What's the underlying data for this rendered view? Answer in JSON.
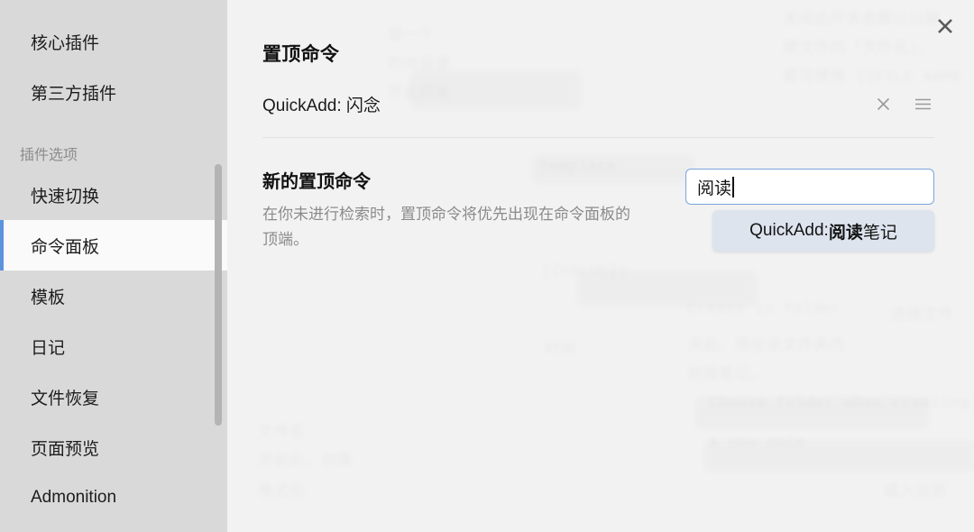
{
  "window": {
    "close_label": "关闭",
    "close_icon": "close-icon"
  },
  "sidebar": {
    "top_items": [
      {
        "label": "核心插件"
      },
      {
        "label": "第三方插件"
      }
    ],
    "section_label": "插件选项",
    "plugin_items": [
      {
        "label": "快速切换",
        "active": false
      },
      {
        "label": "命令面板",
        "active": true
      },
      {
        "label": "模板",
        "active": false
      },
      {
        "label": "日记",
        "active": false
      },
      {
        "label": "文件恢复",
        "active": false
      },
      {
        "label": "页面预览",
        "active": false
      },
      {
        "label": "Admonition",
        "active": false
      }
    ],
    "scrollbar": "vertical-scrollbar",
    "accent_color": "#5c93dd",
    "background_color": "#d9d9d9",
    "active_background_color": "#fafafa"
  },
  "main": {
    "section_title": "置顶命令",
    "pinned_commands": [
      {
        "name": "QuickAdd: 闪念",
        "remove_icon": "close-icon",
        "drag_icon": "hamburger-drag-handle-icon"
      }
    ],
    "setting": {
      "name": "新的置顶命令",
      "description": "在你未进行检索时，置顶命令将优先出现在命令面板的顶端。",
      "input": {
        "value": "阅读",
        "placeholder": "",
        "focused": true,
        "border_color": "#7aa4dd"
      },
      "suggestions": [
        {
          "prefix": "QuickAdd: ",
          "match": "阅读",
          "suffix": "笔记",
          "full_text": "QuickAdd: 阅读笔记",
          "selected": true
        }
      ],
      "suggestion_background_color": "#dde4ee"
    }
  },
  "backdrop": {
    "ghost_lines": [
      "关闭此开关会默认以输",
      "建文件的「文件名」，",
      "或可使用 {{FILE NAME",
      "是一个",
      "的内容使",
      "开此开关",
      "Create in folder",
      "选择文件",
      "夹后，将在该文件夹内",
      "创建笔记。",
      "Choose folder when creating",
      "a new note",
      "开启后，创建",
      "{{VALUE}}",
      "Template",
      "格式化",
      "文件名",
      "插入当前",
      "时间"
    ]
  }
}
